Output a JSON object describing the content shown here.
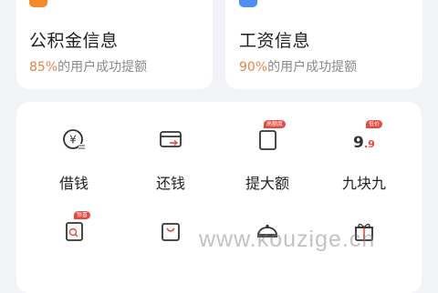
{
  "cards": [
    {
      "title": "公积金信息",
      "percent": "85%",
      "subtitle": "的用户成功提额"
    },
    {
      "title": "工资信息",
      "percent": "90%",
      "subtitle": "的用户成功提额"
    }
  ],
  "grid": {
    "row1": [
      {
        "label": "借钱",
        "icon": "yuan-coin-icon"
      },
      {
        "label": "还钱",
        "icon": "card-return-icon"
      },
      {
        "label": "提大额",
        "icon": "document-icon",
        "badge": "高额度"
      },
      {
        "label": "九块九",
        "icon": "nine-point-nine-icon",
        "badge": "低价"
      }
    ],
    "row2": [
      {
        "label": "",
        "icon": "search-doc-icon",
        "badge": "惊喜"
      },
      {
        "label": "",
        "icon": "shopping-bag-icon"
      },
      {
        "label": "",
        "icon": "food-dome-icon"
      },
      {
        "label": "",
        "icon": "gift-icon"
      }
    ]
  },
  "watermark": "www.kouzige.cn",
  "colors": {
    "orange": "#f38a2c",
    "blue": "#4e8ef0",
    "accent": "#e9483f",
    "percent": "#e2844a"
  }
}
